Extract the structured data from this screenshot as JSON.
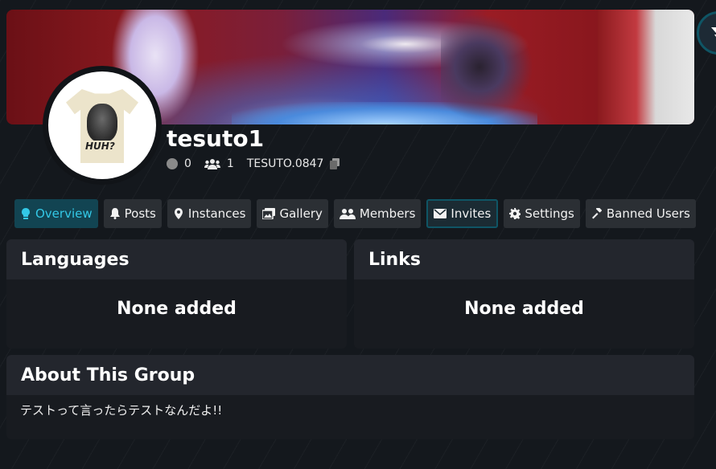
{
  "group": {
    "name": "tesuto1",
    "online_count": "0",
    "member_count": "1",
    "short_code": "TESUTO.0847",
    "avatar_text": "HUH?"
  },
  "tabs": [
    {
      "label": "Overview",
      "icon": "lightbulb-icon",
      "active": true
    },
    {
      "label": "Posts",
      "icon": "bell-icon"
    },
    {
      "label": "Instances",
      "icon": "map-marker-icon"
    },
    {
      "label": "Gallery",
      "icon": "images-icon"
    },
    {
      "label": "Members",
      "icon": "users-icon"
    },
    {
      "label": "Invites",
      "icon": "envelope-icon",
      "focused": true
    },
    {
      "label": "Settings",
      "icon": "gear-icon"
    },
    {
      "label": "Banned Users",
      "icon": "gavel-icon"
    }
  ],
  "languages": {
    "title": "Languages",
    "empty": "None added"
  },
  "links": {
    "title": "Links",
    "empty": "None added"
  },
  "about": {
    "title": "About This Group",
    "text": "テストって言ったらテストなんだよ!!"
  },
  "colors": {
    "accent": "#33c8e6",
    "active_tab_bg": "#124452",
    "panel_header": "#23262d",
    "panel_body": "#181b20",
    "background": "#14181d"
  }
}
